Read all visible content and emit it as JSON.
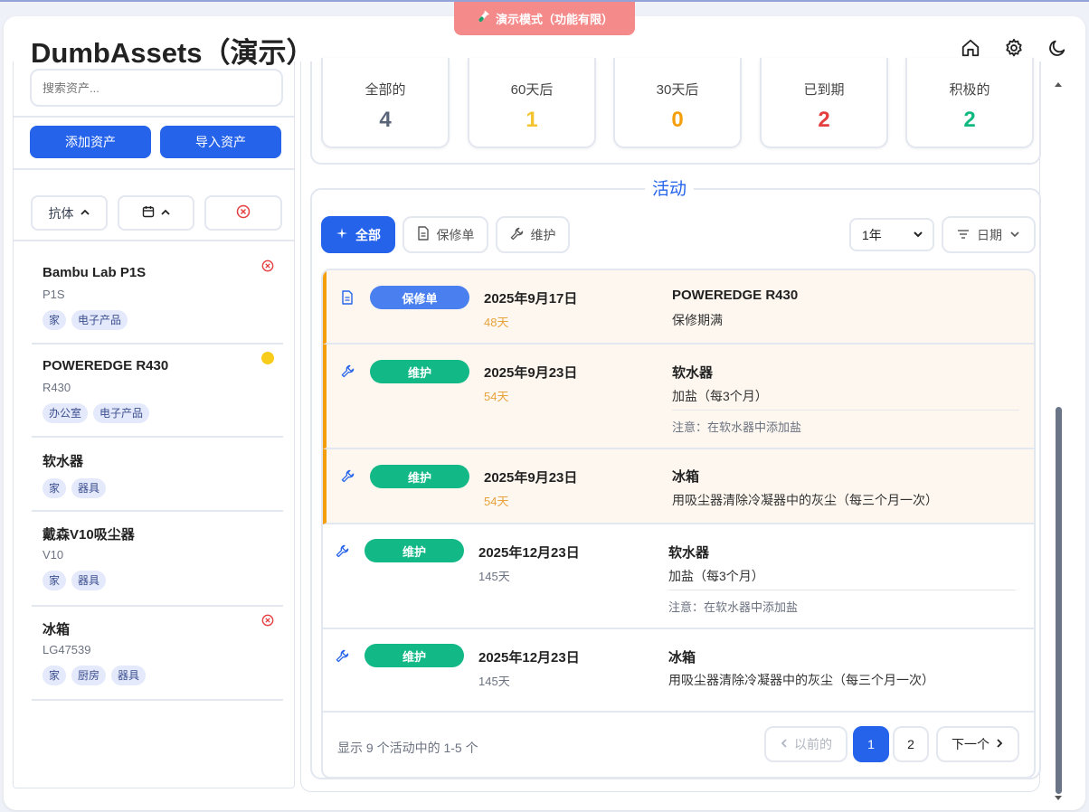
{
  "banner": {
    "text": "演示模式（功能有限）",
    "icon": "test-tube-icon",
    "color": "#f58a8a"
  },
  "app": {
    "title": "DumbAssets（演示）"
  },
  "header_icons": [
    "home-icon",
    "gear-icon",
    "moon-icon"
  ],
  "sidebar": {
    "search_placeholder": "搜索资产...",
    "add_label": "添加资产",
    "import_label": "导入资产",
    "sort_name_label": "抗体",
    "assets": [
      {
        "name": "Bambu Lab P1S",
        "model": "P1S",
        "tags": [
          "家",
          "电子产品"
        ],
        "status": "expired"
      },
      {
        "name": "POWEREDGE R430",
        "model": "R430",
        "tags": [
          "办公室",
          "电子产品"
        ],
        "status": "expiring"
      },
      {
        "name": "软水器",
        "model": "",
        "tags": [
          "家",
          "器具"
        ],
        "status": ""
      },
      {
        "name": "戴森V10吸尘器",
        "model": "V10",
        "tags": [
          "家",
          "器具"
        ],
        "status": ""
      },
      {
        "name": "冰箱",
        "model": "LG47539",
        "tags": [
          "家",
          "厨房",
          "器具"
        ],
        "status": "expired"
      }
    ]
  },
  "stats": [
    {
      "label": "全部的",
      "value": "4",
      "color": "#5a6478"
    },
    {
      "label": "60天后",
      "value": "1",
      "color": "#f4c430"
    },
    {
      "label": "30天后",
      "value": "0",
      "color": "#f59e0b"
    },
    {
      "label": "已到期",
      "value": "2",
      "color": "#e53e3e"
    },
    {
      "label": "积极的",
      "value": "2",
      "color": "#10b981"
    }
  ],
  "activity": {
    "heading": "活动",
    "filters": {
      "all": "全部",
      "warranty": "保修单",
      "maintenance": "维护"
    },
    "period": "1年",
    "sort": "日期",
    "items": [
      {
        "type": "warranty",
        "badge": "保修单",
        "icon": "document-icon",
        "date": "2025年9月17日",
        "days": "48天",
        "title": "POWEREDGE R430",
        "desc": "保修期满",
        "note": "",
        "upcoming": true
      },
      {
        "type": "maintenance",
        "badge": "维护",
        "icon": "wrench-icon",
        "date": "2025年9月23日",
        "days": "54天",
        "title": "软水器",
        "desc": "加盐（每3个月）",
        "note": "注意：在软水器中添加盐",
        "upcoming": true
      },
      {
        "type": "maintenance",
        "badge": "维护",
        "icon": "wrench-icon",
        "date": "2025年9月23日",
        "days": "54天",
        "title": "冰箱",
        "desc": "用吸尘器清除冷凝器中的灰尘（每三个月一次）",
        "note": "",
        "upcoming": true
      },
      {
        "type": "maintenance",
        "badge": "维护",
        "icon": "wrench-icon",
        "date": "2025年12月23日",
        "days": "145天",
        "title": "软水器",
        "desc": "加盐（每3个月）",
        "note": "注意：在软水器中添加盐",
        "upcoming": false
      },
      {
        "type": "maintenance",
        "badge": "维护",
        "icon": "wrench-icon",
        "date": "2025年12月23日",
        "days": "145天",
        "title": "冰箱",
        "desc": "用吸尘器清除冷凝器中的灰尘（每三个月一次）",
        "note": "",
        "upcoming": false
      }
    ],
    "pagination": {
      "info": "显示 9 个活动中的 1-5 个",
      "prev": "以前的",
      "pages": [
        "1",
        "2"
      ],
      "current": "1",
      "next": "下一个"
    }
  },
  "colors": {
    "accent": "#2563eb",
    "warranty": "#4a7ff0",
    "maintenance": "#12b886",
    "upcoming_days": "#e8a23c",
    "expired_marker": "#e53e3e",
    "expiring_marker": "#f8cc1b"
  }
}
